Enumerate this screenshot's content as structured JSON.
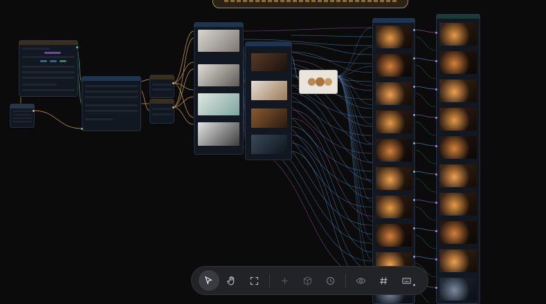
{
  "app": {
    "name": "node-canvas-workflow-editor",
    "accent_color": "#3aa0ff",
    "connection_colors": [
      "#6fb6ff",
      "#e9b44a",
      "#3fd17a",
      "#c678dd"
    ]
  },
  "banner": {
    "text": "",
    "color": "#b98a2a"
  },
  "nodes": [
    {
      "id": "settings",
      "kind": "form",
      "header_color": "#c08a3a"
    },
    {
      "id": "mini-table",
      "kind": "table",
      "header_color": "#3a4a5c"
    },
    {
      "id": "prompt-splitter",
      "kind": "list",
      "header_color": "#2e7fd1"
    },
    {
      "id": "merge-a",
      "kind": "small",
      "header_color": "#c08a3a"
    },
    {
      "id": "merge-b",
      "kind": "small",
      "header_color": "#c08a3a"
    },
    {
      "id": "character-refs",
      "kind": "gallery",
      "header_color": "#2e7fd1"
    },
    {
      "id": "scene-refs",
      "kind": "gallery",
      "header_color": "#2e7fd1"
    },
    {
      "id": "props-ref",
      "kind": "image",
      "header_color": "#2e7fd1"
    },
    {
      "id": "storyboard-a",
      "kind": "column",
      "header_color": "#2e7fd1"
    },
    {
      "id": "storyboard-b",
      "kind": "column",
      "header_color": "#2e9a8a"
    }
  ],
  "toolbar": {
    "tools": [
      {
        "name": "select-tool",
        "icon": "cursor-icon",
        "active": true,
        "enabled": true
      },
      {
        "name": "pan-tool",
        "icon": "hand-icon",
        "active": false,
        "enabled": true
      },
      {
        "name": "fit-view",
        "icon": "frame-icon",
        "active": false,
        "enabled": true
      },
      {
        "name": "add-node",
        "icon": "plus-icon",
        "active": false,
        "enabled": false
      },
      {
        "name": "asset-box",
        "icon": "cube-icon",
        "active": false,
        "enabled": false
      },
      {
        "name": "history",
        "icon": "clock-icon",
        "active": false,
        "enabled": false
      },
      {
        "name": "preview",
        "icon": "eye-icon",
        "active": false,
        "enabled": true
      },
      {
        "name": "grid",
        "icon": "hash-icon",
        "active": false,
        "enabled": true
      },
      {
        "name": "keyboard",
        "icon": "keyboard-icon",
        "active": false,
        "enabled": true
      }
    ]
  }
}
